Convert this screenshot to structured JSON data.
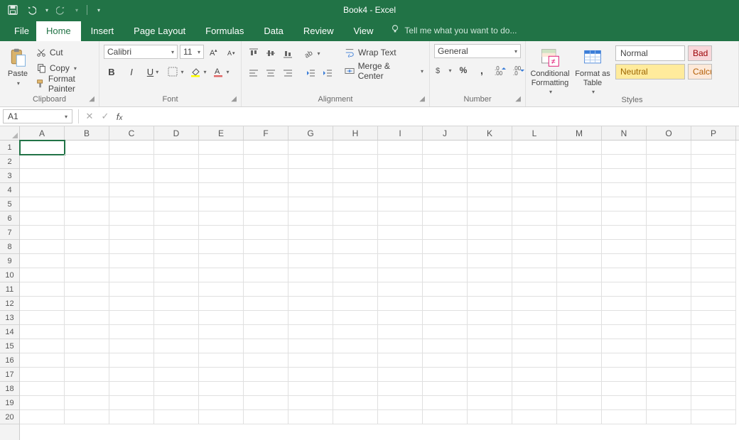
{
  "app": {
    "title": "Book4 - Excel"
  },
  "qat": {
    "save": "save",
    "undo": "undo",
    "redo": "redo"
  },
  "tabs": {
    "file": "File",
    "items": [
      "Home",
      "Insert",
      "Page Layout",
      "Formulas",
      "Data",
      "Review",
      "View"
    ],
    "active": "Home",
    "tellme": "Tell me what you want to do..."
  },
  "ribbon": {
    "clipboard": {
      "label": "Clipboard",
      "paste": "Paste",
      "cut": "Cut",
      "copy": "Copy",
      "format_painter": "Format Painter"
    },
    "font": {
      "label": "Font",
      "name": "Calibri",
      "size": "11"
    },
    "alignment": {
      "label": "Alignment",
      "wrap": "Wrap Text",
      "merge": "Merge & Center"
    },
    "number": {
      "label": "Number",
      "format": "General"
    },
    "styles": {
      "label": "Styles",
      "cond": "Conditional Formatting",
      "table": "Format as Table",
      "cells": [
        {
          "k": "normal",
          "t": "Normal"
        },
        {
          "k": "bad",
          "t": "Bad"
        },
        {
          "k": "neutral",
          "t": "Neutral"
        },
        {
          "k": "calc",
          "t": "Calculation"
        }
      ]
    }
  },
  "formula_bar": {
    "name_box": "A1",
    "value": ""
  },
  "grid": {
    "columns": [
      "A",
      "B",
      "C",
      "D",
      "E",
      "F",
      "G",
      "H",
      "I",
      "J",
      "K",
      "L",
      "M",
      "N",
      "O",
      "P"
    ],
    "rows": [
      "1",
      "2",
      "3",
      "4",
      "5",
      "6",
      "7",
      "8",
      "9",
      "10",
      "11",
      "12",
      "13",
      "14",
      "15",
      "16",
      "17",
      "18",
      "19",
      "20"
    ],
    "active": "A1"
  }
}
